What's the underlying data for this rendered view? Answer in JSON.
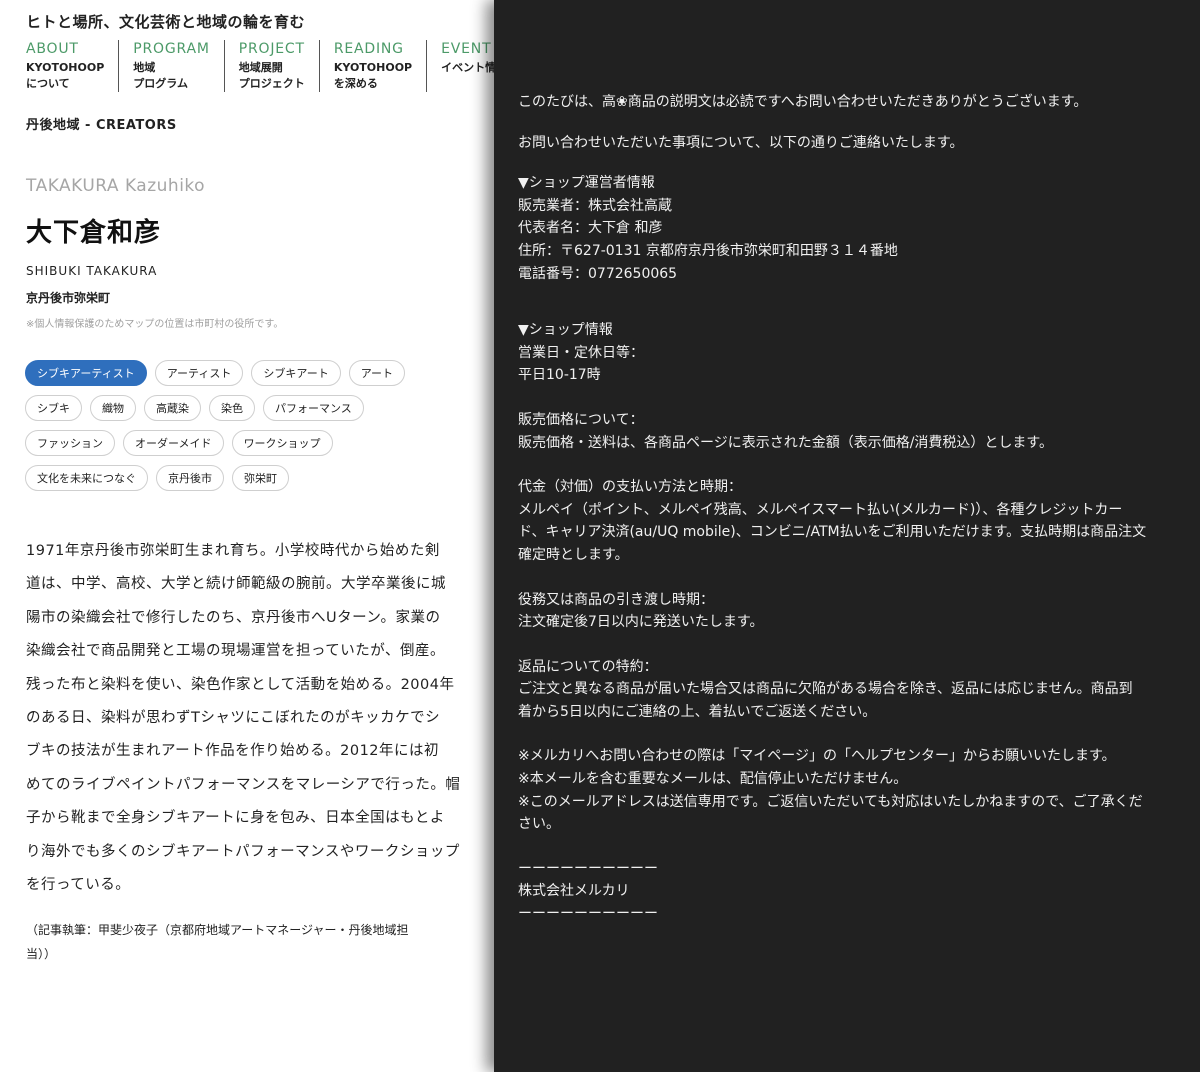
{
  "site": {
    "tagline": "ヒトと場所、文化芸術と地域の輪を育む",
    "nav": [
      {
        "en": "ABOUT",
        "ja1": "KYOTOHOOP",
        "ja2": "について"
      },
      {
        "en": "PROGRAM",
        "ja1": "地域",
        "ja2": "プログラム"
      },
      {
        "en": "PROJECT",
        "ja1": "地域展開",
        "ja2": "プロジェクト"
      },
      {
        "en": "READING",
        "ja1": "KYOTOHOOP",
        "ja2": "を深める"
      },
      {
        "en": "EVENT",
        "ja1": "イベント情報",
        "ja2": ""
      }
    ],
    "breadcrumb": "丹後地域 - CREATORS",
    "romaji": "TAKAKURA Kazuhiko",
    "name": "大下倉和彦",
    "alias": "SHIBUKI TAKAKURA",
    "place": "京丹後市弥栄町",
    "map_note": "※個人情報保護のためマップの位置は市町村の役所です。",
    "tag_rows": [
      [
        "シブキアーティスト",
        "アーティスト",
        "シブキアート",
        "アート"
      ],
      [
        "シブキ",
        "織物",
        "高蔵染",
        "染色",
        "パフォーマンス"
      ],
      [
        "ファッション",
        "オーダーメイド",
        "ワークショップ"
      ],
      [
        "文化を未来につなぐ",
        "京丹後市",
        "弥栄町"
      ]
    ],
    "bio_lines": [
      "1971年京丹後市弥栄町生まれ育ち。小学校時代から始めた剣",
      "道は、中学、高校、大学と続け師範級の腕前。大学卒業後に城",
      "陽市の染織会社で修行したのち、京丹後市へUターン。家業の",
      "染織会社で商品開発と工場の現場運営を担っていたが、倒産。",
      "残った布と染料を使い、染色作家として活動を始める。2004年",
      "のある日、染料が思わずTシャツにこぼれたのがキッカケでシ",
      "ブキの技法が生まれアート作品を作り始める。2012年には初",
      "めてのライブペイントパフォーマンスをマレーシアで行った。帽",
      "子から靴まで全身シブキアートに身を包み、日本全国はもとよ",
      "り海外でも多くのシブキアートパフォーマンスやワークショップ",
      "を行っている。"
    ],
    "credit_lines": [
      "（記事執筆：甲斐少夜子（京都府地域アートマネージャー・丹後地域担",
      "当））"
    ]
  },
  "mail": {
    "greeting": "このたびは、高❀商品の説明文は必読ですへお問い合わせいただきありがとうございます。",
    "intro": "お問い合わせいただいた事項について、以下の通りご連絡いたします。",
    "operator": {
      "heading": "▼ショップ運営者情報",
      "seller": "販売業者：株式会社高蔵",
      "rep": "代表者名：大下倉 和彦",
      "address": "住所：〒627-0131 京都府京丹後市弥栄町和田野３１４番地",
      "phone": "電話番号：0772650065"
    },
    "shop": {
      "heading": "▼ショップ情報",
      "hours_label": "営業日・定休日等：",
      "hours": "平日10-17時"
    },
    "price": {
      "label": "販売価格について：",
      "text": "販売価格・送料は、各商品ページに表示された金額（表示価格/消費税込）とします。"
    },
    "payment": {
      "label": "代金（対価）の支払い方法と時期：",
      "line1": "メルペイ（ポイント、メルペイ残高、メルペイスマート払い(メルカード)）、各種クレジットカー",
      "line2": "ド、キャリア決済(au/UQ mobile)、コンビニ/ATM払いをご利用いただけます。支払時期は商品注文",
      "line3": "確定時とします。"
    },
    "delivery": {
      "label": "役務又は商品の引き渡し時期：",
      "text": "注文確定後7日以内に発送いたします。"
    },
    "returns": {
      "label": "返品についての特約：",
      "line1": "ご注文と異なる商品が届いた場合又は商品に欠陥がある場合を除き、返品には応じません。商品到",
      "line2": "着から5日以内にご連絡の上、着払いでご返送ください。"
    },
    "notes": {
      "line1": "※メルカリへお問い合わせの際は「マイページ」の「ヘルプセンター」からお願いいたします。",
      "line2": "※本メールを含む重要なメールは、配信停止いただけません。",
      "line3": "※このメールアドレスは送信専用です。ご返信いただいても対応はいたしかねますので、ご了承くだ",
      "line4": "さい。"
    },
    "signature": {
      "rule": "ーーーーーーーーーー",
      "company": "株式会社メルカリ"
    }
  }
}
